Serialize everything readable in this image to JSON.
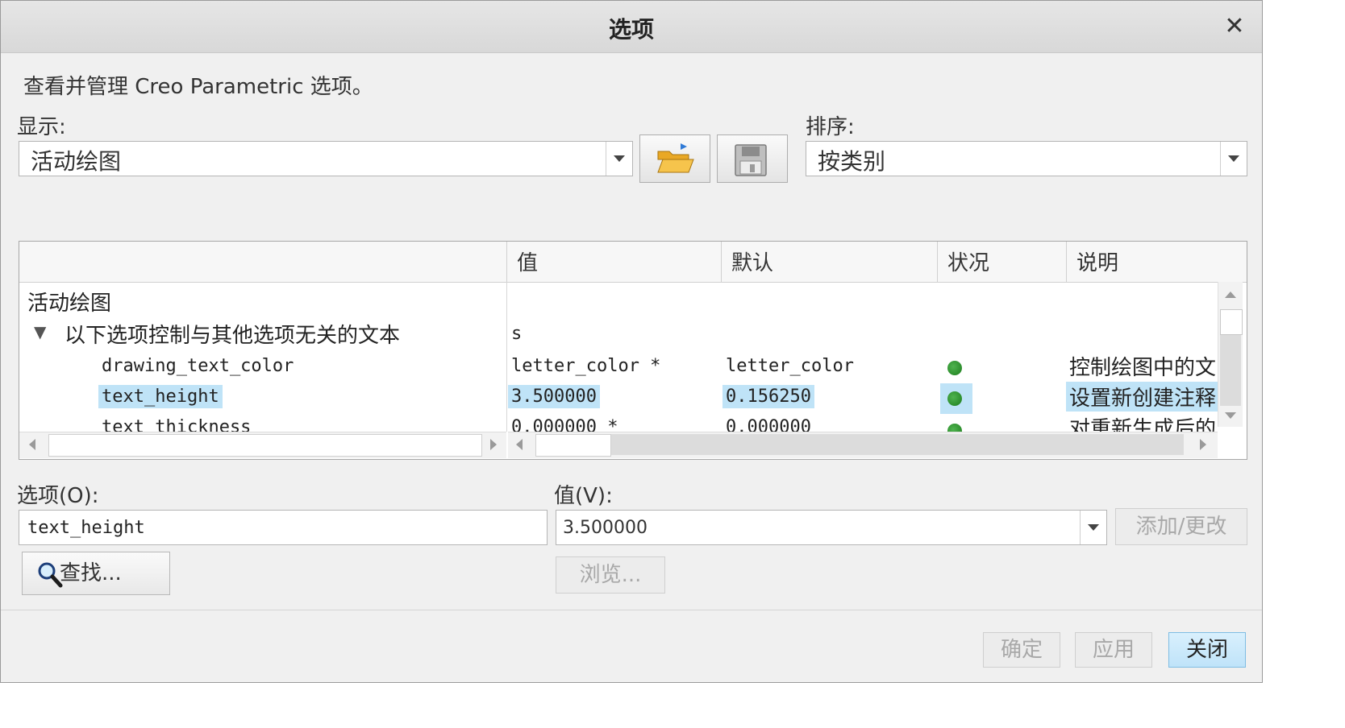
{
  "dialog": {
    "title": "选项",
    "description": "查看并管理 Creo Parametric 选项。",
    "show_label": "显示:",
    "show_value": "活动绘图",
    "sort_label": "排序:",
    "sort_value": "按类别"
  },
  "icons": {
    "open": "folder-open-icon",
    "save": "floppy-save-icon",
    "search": "magnifier-icon",
    "close": "close-icon"
  },
  "table": {
    "columns": [
      "值",
      "默认",
      "状况",
      "说明"
    ],
    "group": "活动绘图",
    "subgroup": "以下选项控制与其他选项无关的文本",
    "subgroup_value": "s",
    "rows": [
      {
        "option": "drawing_text_color",
        "value": "letter_color *",
        "default": "letter_color",
        "desc": "控制绘图中的文"
      },
      {
        "option": "text_height",
        "value": "3.500000",
        "default": "0.156250",
        "desc": "设置新创建注释"
      },
      {
        "option": "text_thickness",
        "value": "0.000000 *",
        "default": "0.000000",
        "desc": "对重新生成后的"
      }
    ]
  },
  "form": {
    "option_label": "选项(O):",
    "option_value": "text_height",
    "value_label": "值(V):",
    "value_value": "3.500000",
    "add_change": "添加/更改",
    "find": "查找...",
    "browse": "浏览..."
  },
  "footer": {
    "ok": "确定",
    "apply": "应用",
    "close": "关闭"
  },
  "colors": {
    "highlight": "#bfe3f7",
    "status_ok": "#2e8b2e",
    "primary_button": "#c9e8fb"
  }
}
